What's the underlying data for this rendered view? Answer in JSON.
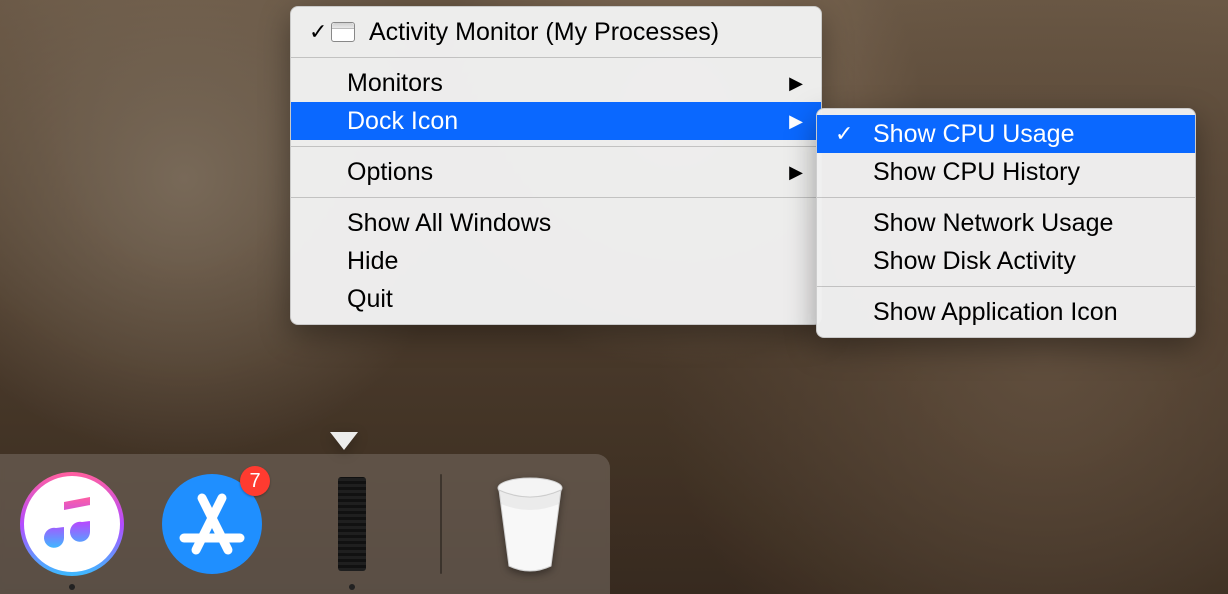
{
  "menu": {
    "window_item": "Activity Monitor (My Processes)",
    "monitors": "Monitors",
    "dock_icon": "Dock Icon",
    "options": "Options",
    "show_all_windows": "Show All Windows",
    "hide": "Hide",
    "quit": "Quit"
  },
  "submenu": {
    "show_cpu_usage": "Show CPU Usage",
    "show_cpu_history": "Show CPU History",
    "show_network_usage": "Show Network Usage",
    "show_disk_activity": "Show Disk Activity",
    "show_application_icon": "Show Application Icon"
  },
  "dock": {
    "app_store_badge": "7"
  }
}
